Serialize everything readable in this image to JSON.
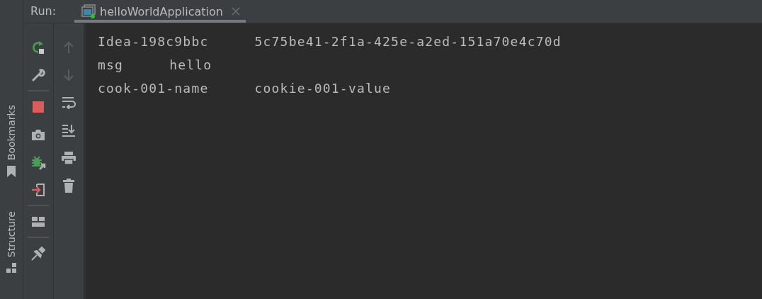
{
  "run_label": "Run:",
  "tab": {
    "title": "helloWorldApplication",
    "selected": true
  },
  "side_tools": [
    {
      "label": "Bookmarks",
      "kind": "bookmarks"
    },
    {
      "label": "Structure",
      "kind": "structure"
    }
  ],
  "console": {
    "lines": [
      {
        "key": "Idea-198c9bbc",
        "value": "5c75be41-2f1a-425e-a2ed-151a70e4c70d"
      },
      {
        "key": "msg",
        "value": "hello"
      },
      {
        "key": "cook-001-name",
        "value": "cookie-001-value"
      }
    ]
  }
}
